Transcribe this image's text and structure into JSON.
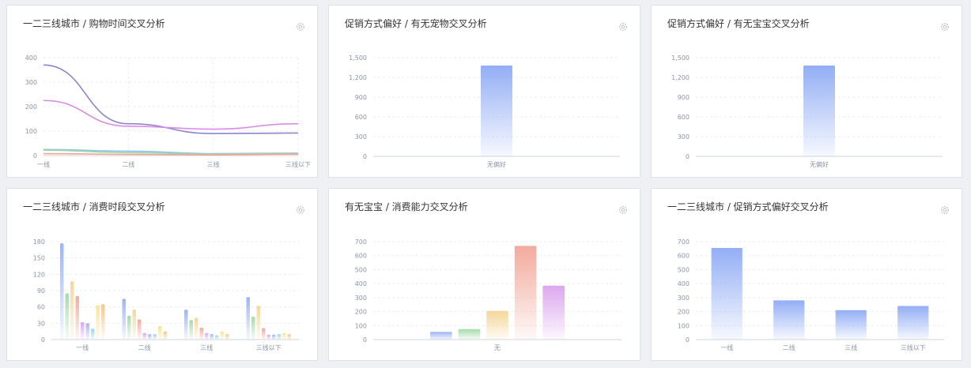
{
  "charts": [
    {
      "id": "c1",
      "title": "一二三线城市 / 购物时间交叉分析",
      "chart_data": {
        "type": "line",
        "categories": [
          "一线",
          "二线",
          "三线",
          "三线以下"
        ],
        "ylim": [
          0,
          400
        ],
        "yticks": [
          0,
          100,
          200,
          300,
          400
        ],
        "grid": true,
        "series": [
          {
            "values": [
              370,
              130,
              90,
              92
            ],
            "color": "#8a86cf"
          },
          {
            "values": [
              225,
              120,
              108,
              130
            ],
            "color": "#d98be6"
          },
          {
            "values": [
              25,
              18,
              8,
              10
            ],
            "color": "#8cc3e8"
          },
          {
            "values": [
              22,
              12,
              6,
              8
            ],
            "color": "#9fd6b0"
          },
          {
            "values": [
              8,
              5,
              3,
              6
            ],
            "color": "#f4a48c"
          }
        ]
      }
    },
    {
      "id": "c2",
      "title": "促销方式偏好 / 有无宠物交叉分析",
      "chart_data": {
        "type": "bar",
        "categories": [
          "无偏好"
        ],
        "values": [
          1380
        ],
        "ylim": [
          0,
          1500
        ],
        "yticks": [
          0,
          300,
          600,
          900,
          1200,
          1500
        ],
        "color": "#93aef5"
      }
    },
    {
      "id": "c3",
      "title": "促销方式偏好 / 有无宝宝交叉分析",
      "chart_data": {
        "type": "bar",
        "categories": [
          "无偏好"
        ],
        "values": [
          1380
        ],
        "ylim": [
          0,
          1500
        ],
        "yticks": [
          0,
          300,
          600,
          900,
          1200,
          1500
        ],
        "color": "#93aef5"
      }
    },
    {
      "id": "c4",
      "title": "一二三线城市 / 消费时段交叉分析",
      "chart_data": {
        "type": "bar",
        "categories": [
          "一线",
          "二线",
          "三线",
          "三线以下"
        ],
        "ylim": [
          0,
          180
        ],
        "yticks": [
          0,
          30,
          60,
          90,
          120,
          150,
          180
        ],
        "colors": [
          "#9db3f5",
          "#a5dbaa",
          "#f4d79b",
          "#f3aa9d",
          "#dda6ef",
          "#a6b5f3",
          "#9fd2ea",
          "#f6e593",
          "#f6c78f"
        ],
        "series": [
          {
            "values": [
              177,
              75,
              55,
              78
            ]
          },
          {
            "values": [
              85,
              44,
              36,
              42
            ]
          },
          {
            "values": [
              107,
              55,
              40,
              62
            ]
          },
          {
            "values": [
              80,
              37,
              22,
              21
            ]
          },
          {
            "values": [
              32,
              12,
              12,
              9
            ]
          },
          {
            "values": [
              30,
              10,
              10,
              9
            ]
          },
          {
            "values": [
              20,
              10,
              8,
              10
            ]
          },
          {
            "values": [
              63,
              25,
              15,
              12
            ]
          },
          {
            "values": [
              65,
              15,
              10,
              10
            ]
          }
        ]
      }
    },
    {
      "id": "c5",
      "title": "有无宝宝 / 消费能力交叉分析",
      "chart_data": {
        "type": "bar",
        "categories": [
          "无"
        ],
        "ylim": [
          0,
          700
        ],
        "yticks": [
          0,
          100,
          200,
          300,
          400,
          500,
          600,
          700
        ],
        "series": [
          {
            "values": [
              55
            ],
            "color": "#9db3f5"
          },
          {
            "values": [
              75
            ],
            "color": "#a5dbaa"
          },
          {
            "values": [
              205
            ],
            "color": "#f4d79b"
          },
          {
            "values": [
              670
            ],
            "color": "#f3aa9d"
          },
          {
            "values": [
              385
            ],
            "color": "#dda6ef"
          }
        ]
      }
    },
    {
      "id": "c6",
      "title": "一二三线城市 / 促销方式偏好交叉分析",
      "chart_data": {
        "type": "bar",
        "categories": [
          "一线",
          "二线",
          "三线",
          "三线以下"
        ],
        "values": [
          655,
          280,
          210,
          240
        ],
        "ylim": [
          0,
          700
        ],
        "yticks": [
          0,
          100,
          200,
          300,
          400,
          500,
          600,
          700
        ],
        "color": "#93aef5"
      }
    }
  ]
}
